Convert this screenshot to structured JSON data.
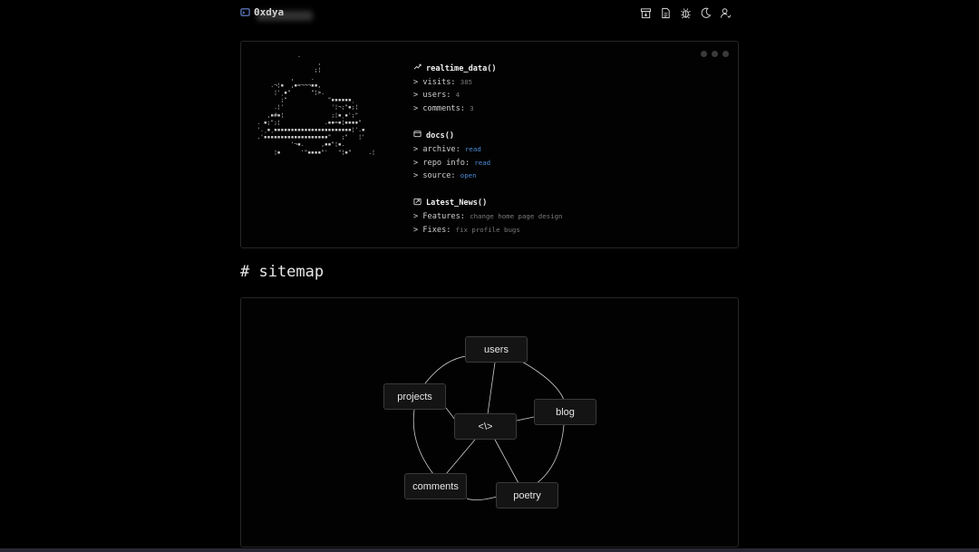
{
  "header": {
    "brand": "0xdya",
    "brand_icon": "terminal-icon",
    "nav_icons": [
      "archive-icon",
      "document-icon",
      "bug-icon",
      "moon-icon",
      "user-icon"
    ]
  },
  "stats_card": {
    "window_dots": 3,
    "ascii_art": "              .\n                    ,\n                   ;¦\n            ,     .\n      .¬¦▪  ,▪=¬¬¬▪▪,\n       ¦'¸▪\"      \"¦>.\n         ;\"            \"▪▪▪▪▪▪¸\n       .¦'              '¦¬;\"▪;¦\n     ,▪#▪¦              ;¦▪¸▪';\"\n  . ▪;\";¦             .▪▪=▪¦▪▪▪▪\"\n  '.¸▪¸▪▪▪▪▪▪▪▪▪▪▪▪▪▪▪▪▪▪▪▪▪▪▪¦'.▪\n  .'▪▪▪▪▪▪▪▪▪▪▪▪▪▪▪▪▪▪▪\"   ;\"   ¦'\n            '¬▪.     ,▪▪\"¦▪.\n       ¦▪      '\"▪▪▪▪\"'   \"¦▪\"     .¦",
    "realtime": {
      "title": "realtime_data()",
      "rows": [
        {
          "label": "visits:",
          "value": "385"
        },
        {
          "label": "users:",
          "value": "4"
        },
        {
          "label": "comments:",
          "value": "3"
        }
      ]
    },
    "docs": {
      "title": "docs()",
      "rows": [
        {
          "label": "archive:",
          "value": "read"
        },
        {
          "label": "repo info:",
          "value": "read"
        },
        {
          "label": "source:",
          "value": "open"
        }
      ]
    },
    "news": {
      "title": "Latest_News()",
      "rows": [
        {
          "label": "Features:",
          "value": "change home page design"
        },
        {
          "label": "Fixes:",
          "value": "fix profile bugs"
        }
      ]
    },
    "prompt": ">"
  },
  "sitemap": {
    "title": "# sitemap",
    "nodes": {
      "center": "<\\>",
      "users": "users",
      "blog": "blog",
      "poetry": "poetry",
      "comments": "comments",
      "projects": "projects"
    }
  },
  "colors": {
    "background": "#000000",
    "border": "#262626",
    "link": "#4a8bd6",
    "muted": "#7a7a7a"
  }
}
